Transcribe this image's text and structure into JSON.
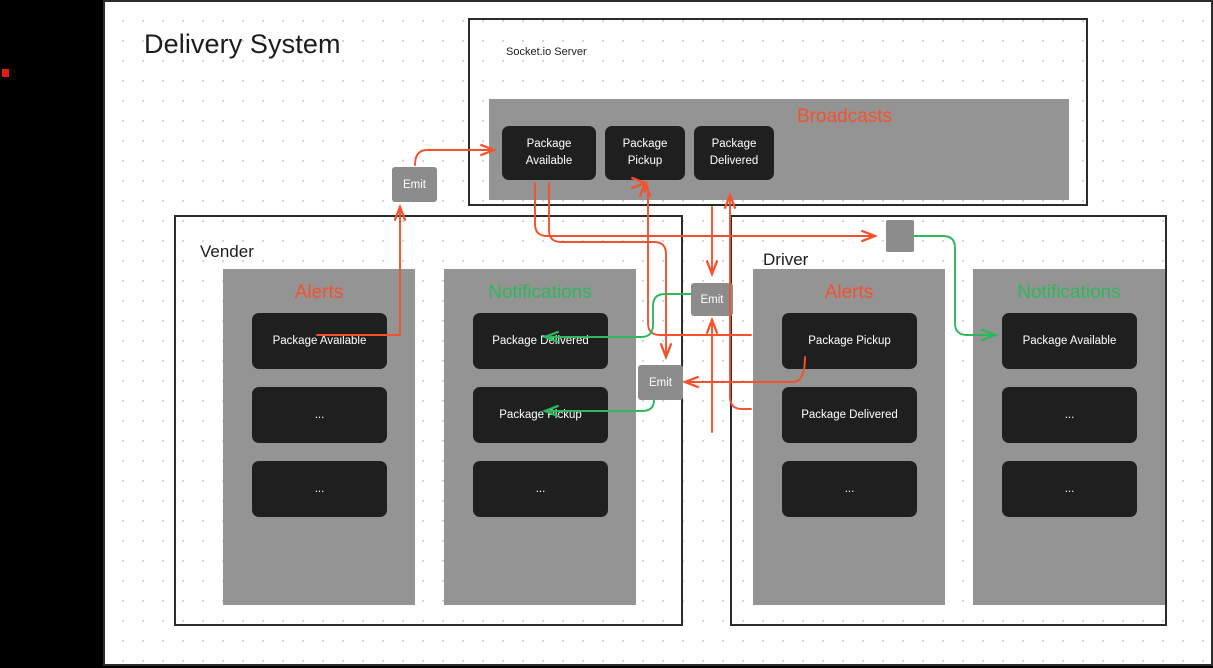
{
  "diagram": {
    "title": "Delivery System",
    "accent_orange": "#f4512c",
    "accent_green": "#2cb85c",
    "panel_gray": "#949494",
    "card_dark": "#1f1f1f",
    "canvas_bg": "#ffffff"
  },
  "server": {
    "label": "Socket.io Server",
    "broadcasts_label": "Broadcasts",
    "events": [
      {
        "line1": "Package",
        "line2": "Available"
      },
      {
        "line1": "Package",
        "line2": "Pickup"
      },
      {
        "line1": "Package",
        "line2": "Delivered"
      }
    ]
  },
  "vender": {
    "label": "Vender",
    "alerts": {
      "title": "Alerts",
      "items": [
        "Package Available",
        "...",
        "..."
      ]
    },
    "notifications": {
      "title": "Notifications",
      "items": [
        "Package Delivered",
        "Package Pickup",
        "..."
      ]
    }
  },
  "driver": {
    "label": "Driver",
    "alerts": {
      "title": "Alerts",
      "items": [
        "Package Pickup",
        "Package Delivered",
        "..."
      ]
    },
    "notifications": {
      "title": "Notifications",
      "items": [
        "Package Available",
        "...",
        "..."
      ]
    }
  },
  "emitters": {
    "vender_alert_emit": "Emit",
    "vender_notify_emit": "Emit",
    "driver_notify_emit": "Emit"
  }
}
